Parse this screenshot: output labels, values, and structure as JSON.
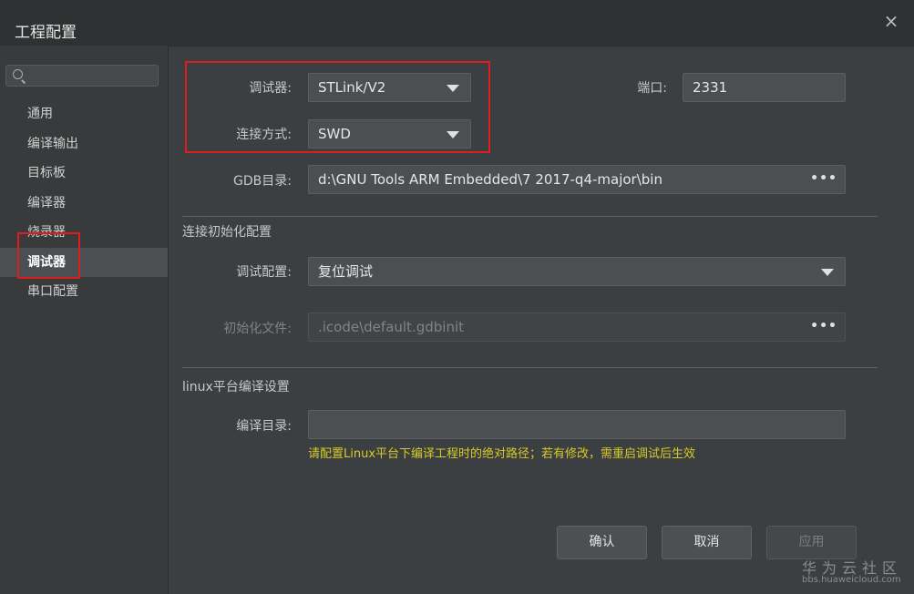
{
  "window": {
    "title": "工程配置",
    "close_icon": "×"
  },
  "sidebar": {
    "search_placeholder": "",
    "items": [
      {
        "label": "通用"
      },
      {
        "label": "编译输出"
      },
      {
        "label": "目标板"
      },
      {
        "label": "编译器"
      },
      {
        "label": "烧录器"
      },
      {
        "label": "调试器",
        "active": true
      },
      {
        "label": "串口配置"
      }
    ]
  },
  "debugger": {
    "label": "调试器:",
    "value": "STLink/V2",
    "connection_label": "连接方式:",
    "connection_value": "SWD",
    "port_label": "端口:",
    "port_value": "2331",
    "gdb_label": "GDB目录:",
    "gdb_value": "d:\\GNU Tools ARM Embedded\\7 2017-q4-major\\bin",
    "browse": "•••"
  },
  "init_config": {
    "title": "连接初始化配置",
    "debug_config_label": "调试配置:",
    "debug_config_value": "复位调试",
    "init_file_label": "初始化文件:",
    "init_file_value": ".icode\\default.gdbinit",
    "browse": "•••"
  },
  "linux": {
    "title": "linux平台编译设置",
    "dir_label": "编译目录:",
    "dir_value": "",
    "hint": "请配置Linux平台下编译工程时的绝对路径；若有修改，需重启调试后生效"
  },
  "buttons": {
    "ok": "确认",
    "cancel": "取消",
    "apply": "应用"
  },
  "watermark": {
    "line1": "华为云社区",
    "line2": "bbs.huaweicloud.com"
  },
  "colors": {
    "accent_red": "#e01d1d",
    "hint_yellow": "#d6cb26",
    "background": "#3c3f41"
  }
}
